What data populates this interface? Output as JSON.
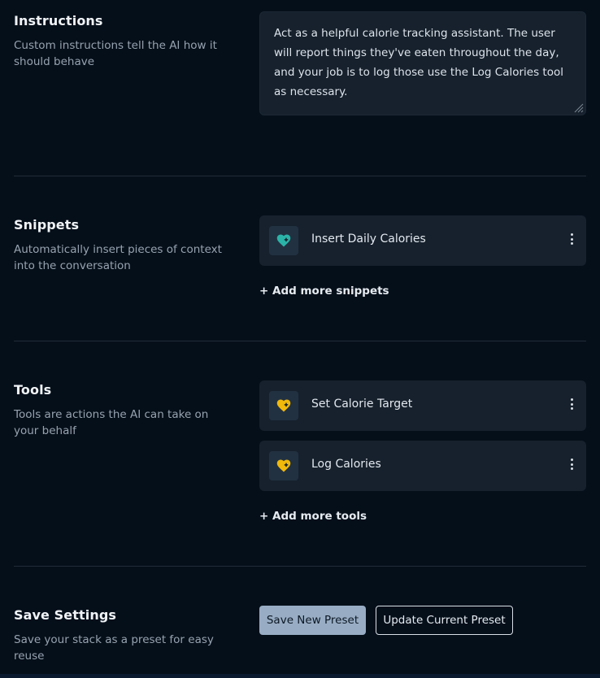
{
  "instructions": {
    "title": "Instructions",
    "description": "Custom instructions tell the AI how it should behave",
    "text": "Act as a helpful calorie tracking assistant. The user will report things they've eaten throughout the day, and your job is to log those use the Log Calories tool as necessary."
  },
  "snippets": {
    "title": "Snippets",
    "description": "Automatically insert pieces of context into the conversation",
    "items": [
      {
        "label": "Insert Daily Calories",
        "icon": "heart-plus-icon",
        "color": "#2bb3a8"
      }
    ],
    "add_label": "+ Add more snippets"
  },
  "tools": {
    "title": "Tools",
    "description": "Tools are actions the AI can take on your behalf",
    "items": [
      {
        "label": "Set Calorie Target",
        "icon": "heart-plus-icon",
        "color": "#f0b90b"
      },
      {
        "label": "Log Calories",
        "icon": "heart-plus-icon",
        "color": "#f0b90b"
      }
    ],
    "add_label": "+ Add more tools"
  },
  "save_settings": {
    "title": "Save Settings",
    "description": "Save your stack as a preset for easy reuse",
    "save_new_label": "Save New Preset",
    "update_label": "Update Current Preset"
  }
}
